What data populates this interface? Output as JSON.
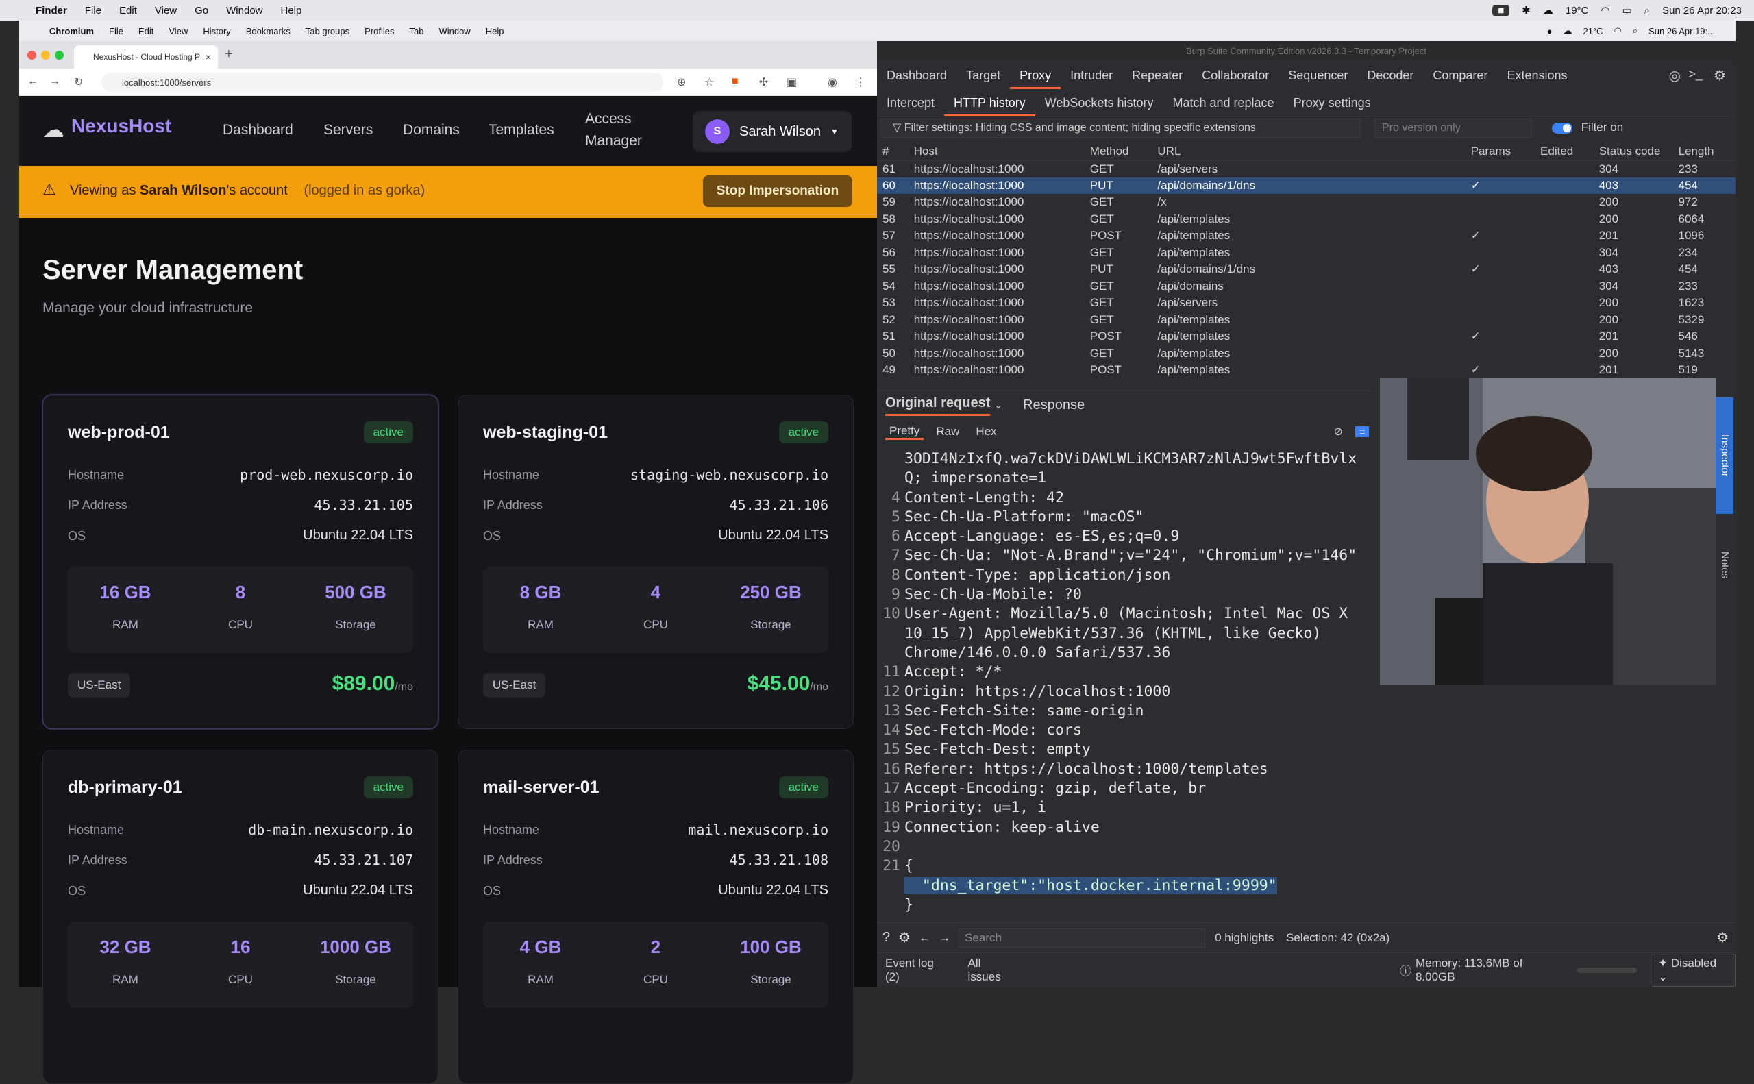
{
  "macbar": {
    "apple": "",
    "app": "Finder",
    "menus": [
      "File",
      "Edit",
      "View",
      "Go",
      "Window",
      "Help"
    ],
    "temp": "19°C",
    "datetime": "Sun 26 Apr  20:23"
  },
  "subbar": {
    "app": "Chromium",
    "menus": [
      "File",
      "Edit",
      "View",
      "History",
      "Bookmarks",
      "Tab groups",
      "Profiles",
      "Tab",
      "Window",
      "Help"
    ],
    "temp": "21°C",
    "datetime": "Sun 26 Apr  19:..."
  },
  "browser": {
    "tab_title": "NexusHost - Cloud Hosting P",
    "url": "localhost:1000/servers"
  },
  "site": {
    "logo": "NexusHost",
    "nav": [
      "Dashboard",
      "Servers",
      "Domains",
      "Templates",
      "Access",
      "Manager"
    ],
    "user": {
      "initial": "S",
      "name": "Sarah Wilson"
    },
    "banner": {
      "prefix": "Viewing as ",
      "name": "Sarah Wilson",
      "suffix": "'s account",
      "note": "(logged in as gorka)",
      "button": "Stop Impersonation"
    },
    "title": "Server Management",
    "subtitle": "Manage your cloud infrastructure",
    "labels": {
      "hostname": "Hostname",
      "ip": "IP Address",
      "os": "OS",
      "ram": "RAM",
      "cpu": "CPU",
      "storage": "Storage",
      "per": "/mo"
    },
    "servers": [
      {
        "name": "web-prod-01",
        "status": "active",
        "hostname": "prod-web.nexuscorp.io",
        "ip": "45.33.21.105",
        "os": "Ubuntu 22.04 LTS",
        "ram": "16 GB",
        "cpu": "8",
        "storage": "500 GB",
        "region": "US-East",
        "price": "$89.00"
      },
      {
        "name": "web-staging-01",
        "status": "active",
        "hostname": "staging-web.nexuscorp.io",
        "ip": "45.33.21.106",
        "os": "Ubuntu 22.04 LTS",
        "ram": "8 GB",
        "cpu": "4",
        "storage": "250 GB",
        "region": "US-East",
        "price": "$45.00"
      },
      {
        "name": "db-primary-01",
        "status": "active",
        "hostname": "db-main.nexuscorp.io",
        "ip": "45.33.21.107",
        "os": "Ubuntu 22.04 LTS",
        "ram": "32 GB",
        "cpu": "16",
        "storage": "1000 GB"
      },
      {
        "name": "mail-server-01",
        "status": "active",
        "hostname": "mail.nexuscorp.io",
        "ip": "45.33.21.108",
        "os": "Ubuntu 22.04 LTS",
        "ram": "4 GB",
        "cpu": "2",
        "storage": "100 GB"
      }
    ]
  },
  "burp": {
    "title": "Burp Suite Community Edition v2026.3.3 - Temporary Project",
    "toptabs": [
      "Dashboard",
      "Target",
      "Proxy",
      "Intruder",
      "Repeater",
      "Collaborator",
      "Sequencer",
      "Decoder",
      "Comparer",
      "Extensions"
    ],
    "subtabs": [
      "Intercept",
      "HTTP history",
      "WebSockets history",
      "Match and replace",
      "Proxy settings"
    ],
    "filter": "Filter settings: Hiding CSS and image content; hiding specific extensions",
    "pro_placeholder": "Pro version only",
    "filter_on": "Filter on",
    "columns": [
      "#",
      "Host",
      "Method",
      "URL",
      "Params",
      "Edited",
      "Status code",
      "Length"
    ],
    "rows": [
      [
        "61",
        "https://localhost:1000",
        "GET",
        "/api/servers",
        "",
        "",
        "304",
        "233"
      ],
      [
        "60",
        "https://localhost:1000",
        "PUT",
        "/api/domains/1/dns",
        "✓",
        "",
        "403",
        "454"
      ],
      [
        "59",
        "https://localhost:1000",
        "GET",
        "/x",
        "",
        "",
        "200",
        "972"
      ],
      [
        "58",
        "https://localhost:1000",
        "GET",
        "/api/templates",
        "",
        "",
        "200",
        "6064"
      ],
      [
        "57",
        "https://localhost:1000",
        "POST",
        "/api/templates",
        "✓",
        "",
        "201",
        "1096"
      ],
      [
        "56",
        "https://localhost:1000",
        "GET",
        "/api/templates",
        "",
        "",
        "304",
        "234"
      ],
      [
        "55",
        "https://localhost:1000",
        "PUT",
        "/api/domains/1/dns",
        "✓",
        "",
        "403",
        "454"
      ],
      [
        "54",
        "https://localhost:1000",
        "GET",
        "/api/domains",
        "",
        "",
        "304",
        "233"
      ],
      [
        "53",
        "https://localhost:1000",
        "GET",
        "/api/servers",
        "",
        "",
        "200",
        "1623"
      ],
      [
        "52",
        "https://localhost:1000",
        "GET",
        "/api/templates",
        "",
        "",
        "200",
        "5329"
      ],
      [
        "51",
        "https://localhost:1000",
        "POST",
        "/api/templates",
        "✓",
        "",
        "201",
        "546"
      ],
      [
        "50",
        "https://localhost:1000",
        "GET",
        "/api/templates",
        "",
        "",
        "200",
        "5143"
      ],
      [
        "49",
        "https://localhost:1000",
        "POST",
        "/api/templates",
        "✓",
        "",
        "201",
        "519"
      ]
    ],
    "req_tabs": [
      "Original request",
      "Response"
    ],
    "view_tabs": [
      "Pretty",
      "Raw",
      "Hex"
    ],
    "code": [
      [
        "",
        "3ODI4NzIxfQ.wa7ckDViDAWLWLiKCM3AR7zNlAJ9wt5FwftBvlx"
      ],
      [
        "",
        "Q; impersonate=1"
      ],
      [
        "4",
        "Content-Length: 42"
      ],
      [
        "5",
        "Sec-Ch-Ua-Platform: \"macOS\""
      ],
      [
        "6",
        "Accept-Language: es-ES,es;q=0.9"
      ],
      [
        "7",
        "Sec-Ch-Ua: \"Not-A.Brand\";v=\"24\", \"Chromium\";v=\"146\""
      ],
      [
        "8",
        "Content-Type: application/json"
      ],
      [
        "9",
        "Sec-Ch-Ua-Mobile: ?0"
      ],
      [
        "10",
        "User-Agent: Mozilla/5.0 (Macintosh; Intel Mac OS X"
      ],
      [
        "",
        "10_15_7) AppleWebKit/537.36 (KHTML, like Gecko)"
      ],
      [
        "",
        "Chrome/146.0.0.0 Safari/537.36"
      ],
      [
        "11",
        "Accept: */*"
      ],
      [
        "12",
        "Origin: https://localhost:1000"
      ],
      [
        "13",
        "Sec-Fetch-Site: same-origin"
      ],
      [
        "14",
        "Sec-Fetch-Mode: cors"
      ],
      [
        "15",
        "Sec-Fetch-Dest: empty"
      ],
      [
        "16",
        "Referer: https://localhost:1000/templates"
      ],
      [
        "17",
        "Accept-Encoding: gzip, deflate, br"
      ],
      [
        "18",
        "Priority: u=1, i"
      ],
      [
        "19",
        "Connection: keep-alive"
      ],
      [
        "20",
        ""
      ],
      [
        "21",
        "{"
      ],
      [
        "",
        "  \"dns_target\":\"host.docker.internal:9999\""
      ],
      [
        "",
        "}"
      ]
    ],
    "search_placeholder": "Search",
    "highlights": "0 highlights",
    "selection": "Selection: 42 (0x2a)",
    "inspector": "Inspector",
    "notes": "Notes",
    "event_log": "Event log (2)",
    "all_issues": "All issues",
    "memory": "Memory: 113.6MB of 8.00GB",
    "disabled": "Disabled"
  }
}
